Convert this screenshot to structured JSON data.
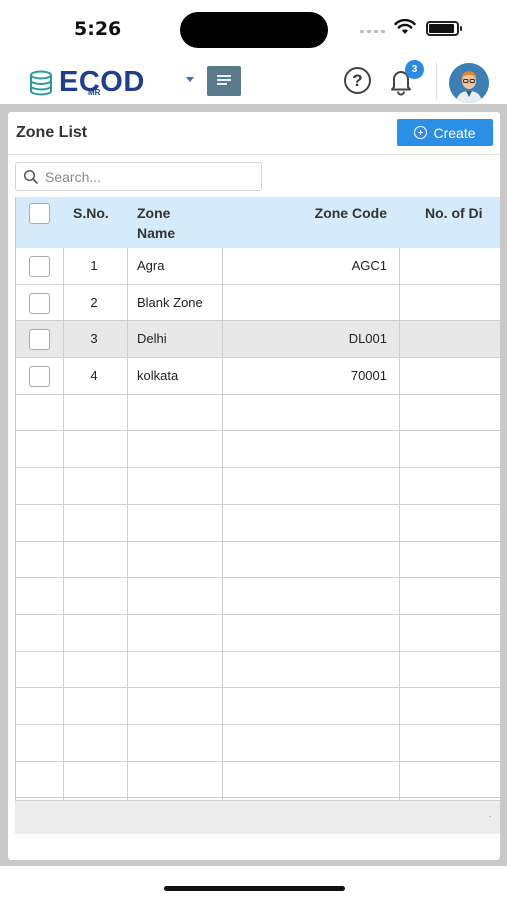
{
  "status": {
    "time": "5:26"
  },
  "header": {
    "logo_text": "ECOD",
    "logo_sub": "MR",
    "help_label": "?",
    "notification_count": "3",
    "brand_color": "#1e3f8f",
    "accent_color": "#2b8fe6"
  },
  "page": {
    "title": "Zone List",
    "create_label": "Create"
  },
  "search": {
    "placeholder": "Search..."
  },
  "table": {
    "columns": [
      "S.No.",
      "Zone Name",
      "Zone Code",
      "No. of Di"
    ],
    "rows": [
      {
        "sno": "1",
        "name": "Agra",
        "code": "AGC1",
        "highlighted": false
      },
      {
        "sno": "2",
        "name": "Blank Zone",
        "code": "",
        "highlighted": false
      },
      {
        "sno": "3",
        "name": "Delhi",
        "code": "DL001",
        "highlighted": true
      },
      {
        "sno": "4",
        "name": "kolkata",
        "code": "70001",
        "highlighted": false
      }
    ],
    "empty_rows": 11
  },
  "footer": {
    "marker": "."
  }
}
